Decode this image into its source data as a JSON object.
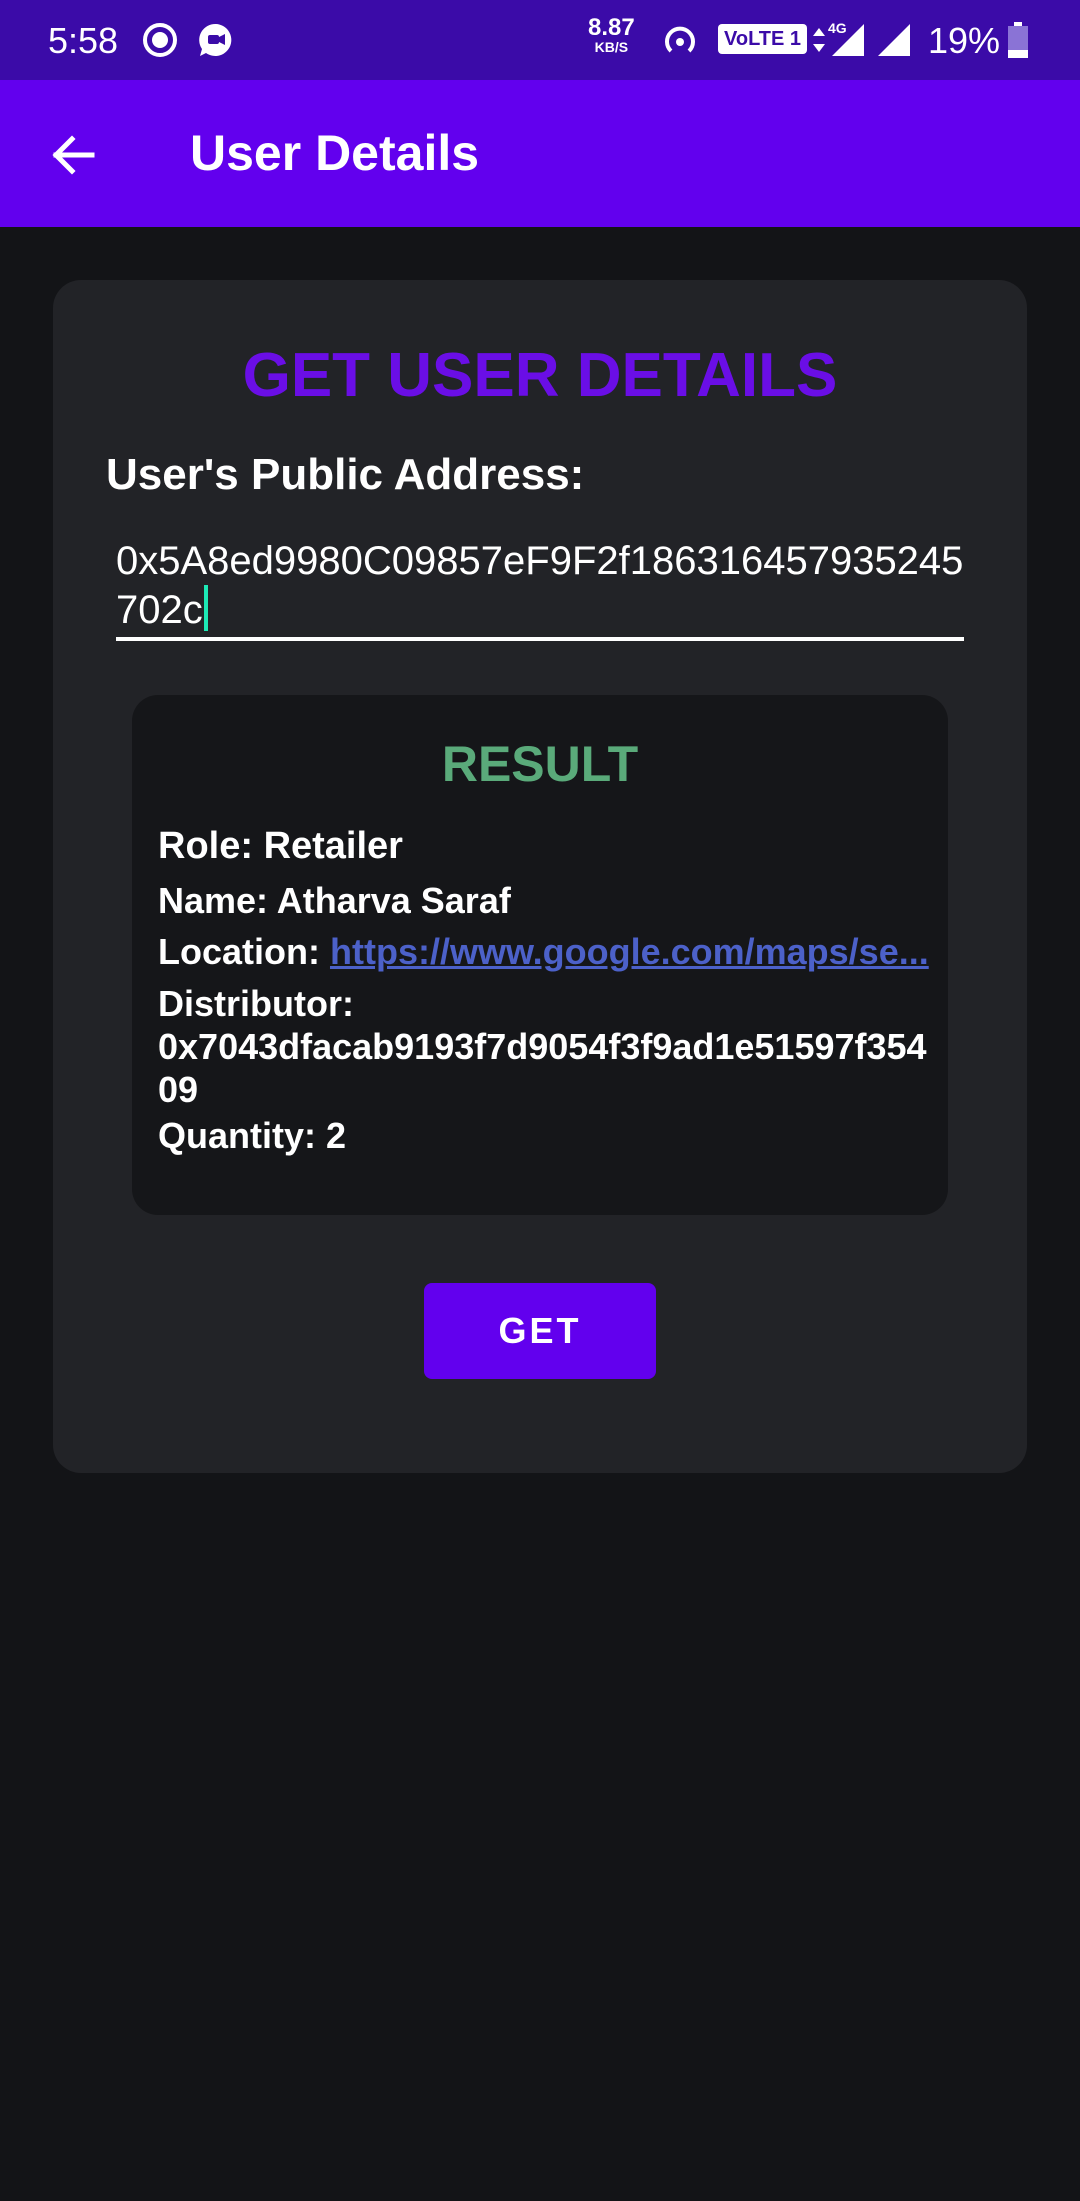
{
  "status_bar": {
    "time": "5:58",
    "net_speed_value": "8.87",
    "net_speed_unit": "KB/S",
    "volte": "VoLTE 1",
    "network_type": "4G",
    "battery": "19%",
    "icons": [
      "record-icon",
      "chat-icon",
      "hotspot-icon",
      "signal-icon",
      "signal-icon",
      "battery-icon"
    ]
  },
  "app_bar": {
    "title": "User Details",
    "back_icon": "arrow-left-icon"
  },
  "form": {
    "heading": "GET USER DETAILS",
    "address_label": "User's Public Address:",
    "address_value": "0x5A8ed9980C09857eF9F2f186316457935245702c"
  },
  "result": {
    "heading": "RESULT",
    "role_label": "Role: ",
    "role_value": "Retailer",
    "name_label": "Name: ",
    "name_value": "Atharva Saraf",
    "location_label": "Location: ",
    "location_value": "https://www.google.com/maps/se...",
    "distributor_label": "Distributor:",
    "distributor_value": "0x7043dfacab9193f7d9054f3f9ad1e51597f35409",
    "quantity_label": "Quantity: ",
    "quantity_value": "2"
  },
  "actions": {
    "get_label": "GET"
  },
  "colors": {
    "status_bar": "#3b0ba8",
    "app_bar": "#6200ee",
    "background": "#131417",
    "card": "#222327",
    "result_card": "#151619",
    "heading": "#6a0ee6",
    "result_heading": "#5aaa7a",
    "link": "#4c61c9",
    "caret": "#1de9b6"
  }
}
